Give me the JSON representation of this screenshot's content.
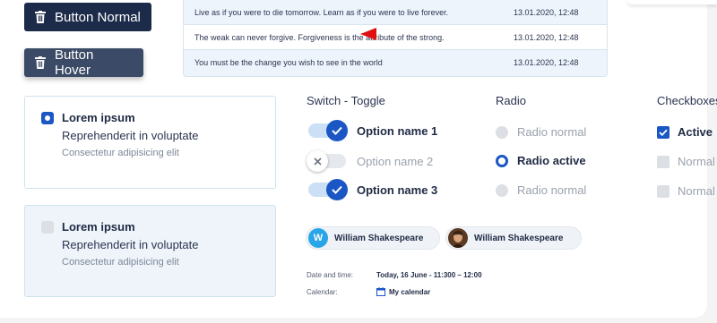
{
  "buttons": {
    "normal_label": "Button Normal",
    "hover_label": "Button Hover"
  },
  "quotes": [
    {
      "text": "Live as if you were to die tomorrow. Learn as if you were to live forever.",
      "date": "13.01.2020, 12:48"
    },
    {
      "text": "The weak can never forgive. Forgiveness is the attribute of the strong.",
      "date": "13.01.2020, 12:48"
    },
    {
      "text": "You must be the change you wish to see in the world",
      "date": "13.01.2020, 12:48"
    }
  ],
  "cards": [
    {
      "title": "Lorem ipsum",
      "line2": "Reprehenderit in voluptate",
      "line3": "Consectetur adipisicing elit",
      "selected": true
    },
    {
      "title": "Lorem ipsum",
      "line2": "Reprehenderit in voluptate",
      "line3": "Consectetur adipisicing elit",
      "selected": false
    }
  ],
  "switch_section": {
    "title": "Switch - Toggle",
    "options": [
      {
        "label": "Option name 1",
        "on": true
      },
      {
        "label": "Option name 2",
        "on": false
      },
      {
        "label": "Option name 3",
        "on": true
      }
    ]
  },
  "radio_section": {
    "title": "Radio",
    "options": [
      {
        "label": "Radio normal",
        "active": false
      },
      {
        "label": "Radio active",
        "active": true
      },
      {
        "label": "Radio normal",
        "active": false
      }
    ]
  },
  "checkbox_section": {
    "title": "Checkboxes",
    "options": [
      {
        "label": "Active",
        "checked": true
      },
      {
        "label": "Normal",
        "checked": false
      },
      {
        "label": "Normal",
        "checked": false
      }
    ]
  },
  "chips": [
    {
      "initial": "W",
      "name": "William Shakespeare"
    },
    {
      "name": "William Shakespeare"
    }
  ],
  "meta": {
    "date_label": "Date and time:",
    "date_value": "Today, 16 June - 11:300 – 12:00",
    "calendar_label": "Calendar:",
    "calendar_value": "My calendar"
  },
  "colors": {
    "accent": "#1a56c4",
    "button_normal": "#1c2b4a",
    "button_hover": "#3b4a66",
    "arrow": "#e01010"
  }
}
